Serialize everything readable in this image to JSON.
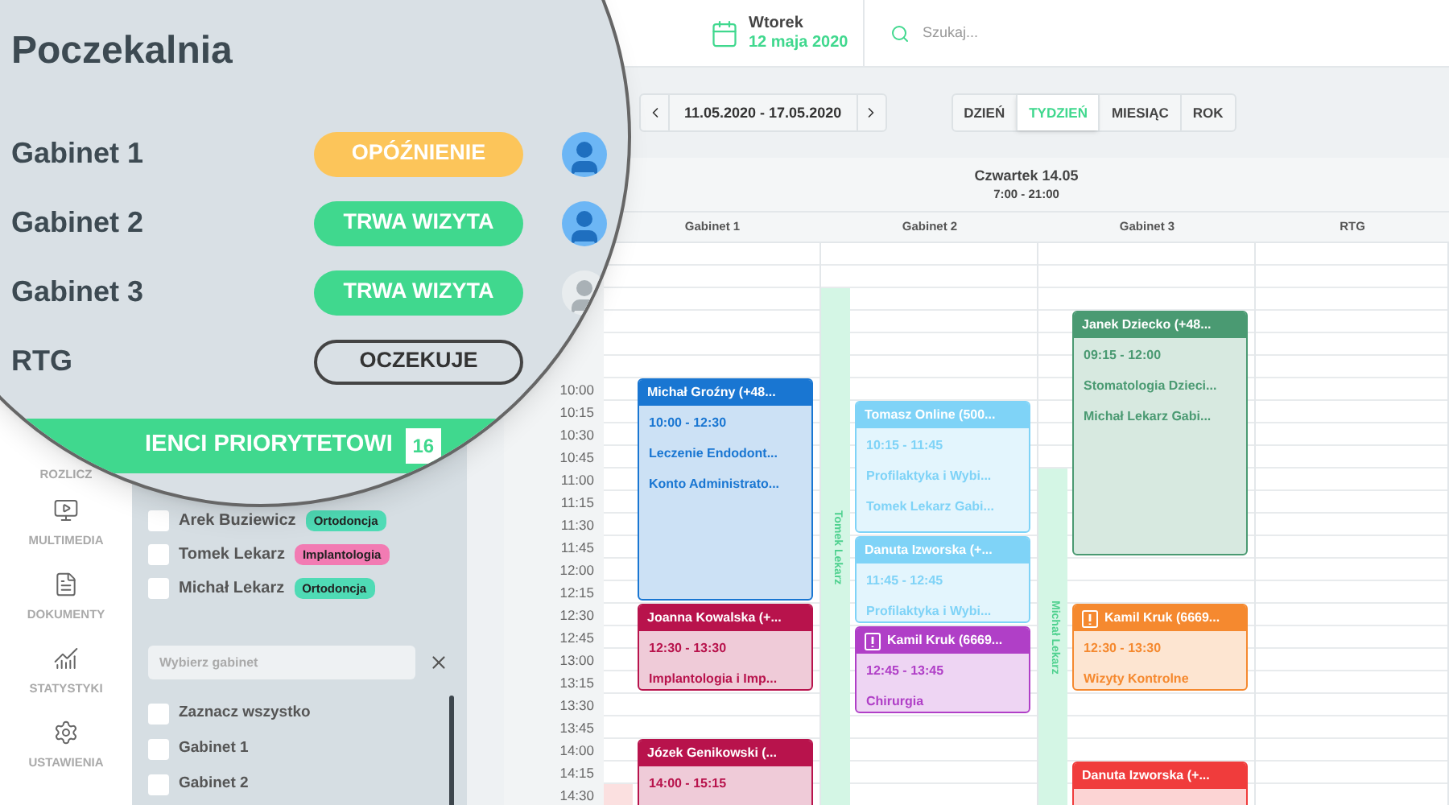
{
  "waiting_room": {
    "title": "Poczekalnia",
    "rooms": [
      {
        "name": "Gabinet 1",
        "status": "OPÓŹNIENIE",
        "kind": "delay",
        "avatar_active": true
      },
      {
        "name": "Gabinet 2",
        "status": "TRWA WIZYTA",
        "kind": "visit",
        "avatar_active": true
      },
      {
        "name": "Gabinet 3",
        "status": "TRWA WIZYTA",
        "kind": "visit",
        "avatar_active": false
      },
      {
        "name": "RTG",
        "status": "OCZEKUJE",
        "kind": "waiting"
      }
    ],
    "priority_header": {
      "title": "IENCI PRIORYTETOWI",
      "count": "16"
    }
  },
  "header": {
    "day": "Wtorek",
    "date": "12 maja 2020",
    "search": {
      "placeholder": "Szukaj..."
    }
  },
  "nav": [
    {
      "label": "ROZLICZ",
      "kind": "none"
    },
    {
      "label": "MULTIMEDIA",
      "kind": "multimedia"
    },
    {
      "label": "DOKUMENTY",
      "kind": "documents"
    },
    {
      "label": "STATYSTYKI",
      "kind": "stats"
    },
    {
      "label": "USTAWIENIA",
      "kind": "settings"
    }
  ],
  "priority_patients": [
    {
      "name": "Arek Buziewicz",
      "checked": false,
      "tag": "Ortodoncja",
      "color": "#4fdbb5"
    },
    {
      "name": "Tomek Lekarz",
      "checked": false,
      "tag": "Implantologia",
      "color": "#f27bb3"
    },
    {
      "name": "Michał Lekarz",
      "checked": false,
      "tag": "Ortodoncja",
      "color": "#4fdbb5"
    }
  ],
  "room_filter": {
    "placeholder": "Wybierz gabinet",
    "options": [
      {
        "label": "Zaznacz wszystko",
        "checked": false
      },
      {
        "label": "Gabinet 1",
        "checked": false
      },
      {
        "label": "Gabinet 2",
        "checked": false
      }
    ]
  },
  "toolbar": {
    "range": "11.05.2020 - 17.05.2020",
    "views": [
      {
        "label": "DZIEŃ",
        "selected": false
      },
      {
        "label": "TYDZIEŃ",
        "selected": true
      },
      {
        "label": "MIESIĄC",
        "selected": false
      },
      {
        "label": "ROK",
        "selected": false
      }
    ]
  },
  "calendar": {
    "day": "Czwartek 14.05",
    "hours": "7:00 - 21:00",
    "times": [
      "10:00",
      "10:15",
      "10:30",
      "10:45",
      "11:00",
      "11:15",
      "11:30",
      "11:45",
      "12:00",
      "12:15",
      "12:30",
      "12:45",
      "13:00",
      "13:15",
      "13:30",
      "13:45",
      "14:00",
      "14:15",
      "14:30"
    ],
    "columns": [
      {
        "name": "Gabinet 1",
        "strips": [
          {
            "color": "#fbe0e0"
          }
        ],
        "events": [
          {
            "title": "Michał Groźny (+48...",
            "time": "10:00 - 12:30",
            "lines": [
              "Leczenie Endodont...",
              "Konto Administrato..."
            ],
            "color": "#1976d2",
            "alert": false
          },
          {
            "title": "Joanna Kowalska (+...",
            "time": "12:30 - 13:30",
            "lines": [
              "Implantologia i Imp..."
            ],
            "color": "#b8134c",
            "alert": false
          },
          {
            "title": "Józek Genikowski (...",
            "time": "14:00 - 15:15",
            "color": "#b8134c",
            "alert": false
          }
        ]
      },
      {
        "name": "Gabinet 2",
        "strips": [
          {
            "name": "Tomek Lekarz",
            "color": "#d4f6e5"
          }
        ],
        "events": [
          {
            "title": "Tomasz Online (500...",
            "time": "10:15 - 11:45",
            "lines": [
              "Profilaktyka i Wybi...",
              "Tomek Lekarz Gabi..."
            ],
            "color": "#7fd3f7",
            "alert": false
          },
          {
            "title": "Danuta Izworska (+...",
            "time": "11:45 - 12:45",
            "lines": [
              "Profilaktyka i Wybi..."
            ],
            "color": "#7fd3f7",
            "alert": false
          },
          {
            "title": "Kamil Kruk (6669...",
            "time": "12:45 - 13:45",
            "lines": [
              "Chirurgia"
            ],
            "color": "#b03fc7",
            "alert": true
          }
        ]
      },
      {
        "name": "Gabinet 3",
        "strips": [
          {
            "name": "Michał Lekarz",
            "color": "#d4f6e5"
          }
        ],
        "events": [
          {
            "title": "Janek Dziecko (+48...",
            "time": "09:15 - 12:00",
            "lines": [
              "Stomatologia Dzieci...",
              "Michał Lekarz Gabi..."
            ],
            "color": "#4a9a72",
            "alert": false
          },
          {
            "title": "Kamil Kruk (6669...",
            "time": "12:30 - 13:30",
            "lines": [
              "Wizyty Kontrolne"
            ],
            "color": "#f5892f",
            "alert": true
          },
          {
            "title": "Danuta Izworska (+...",
            "color": "#f03c3c",
            "alert": false
          }
        ]
      },
      {
        "name": "RTG"
      }
    ]
  }
}
